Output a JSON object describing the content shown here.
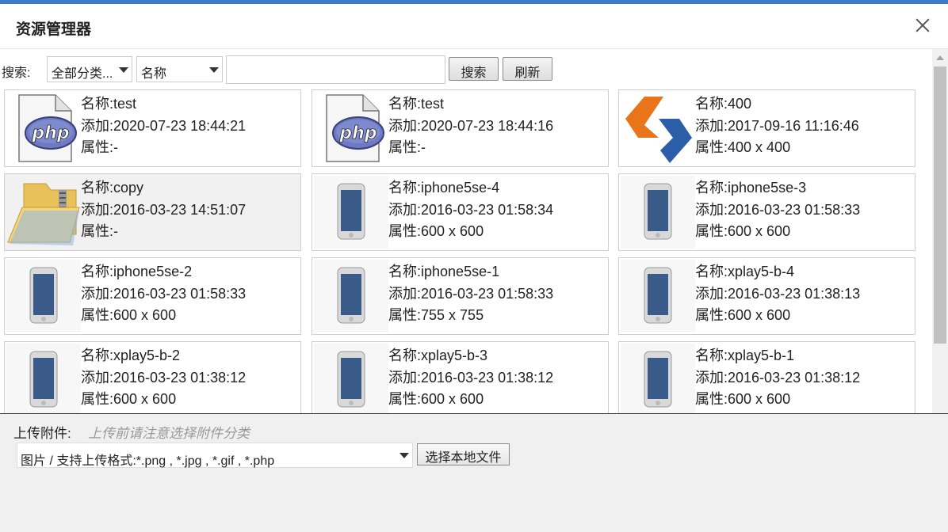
{
  "dialog": {
    "title": "资源管理器",
    "close_label": "×"
  },
  "toolbar": {
    "search_label": "搜索:",
    "category_select": "全部分类...",
    "field_select": "名称",
    "search_input_value": "",
    "search_button": "搜索",
    "refresh_button": "刷新"
  },
  "labels": {
    "name": "名称:",
    "added": "添加:",
    "attr": "属性:"
  },
  "files": [
    {
      "name": "test",
      "added": "2020-07-23 18:44:21",
      "attr": "-",
      "thumb": "php-file-icon"
    },
    {
      "name": "test",
      "added": "2020-07-23 18:44:16",
      "attr": "-",
      "thumb": "php-file-icon"
    },
    {
      "name": "400",
      "added": "2017-09-16 11:16:46",
      "attr": "400 x 400",
      "thumb": "logo-image"
    },
    {
      "name": "copy",
      "added": "2016-03-23 14:51:07",
      "attr": "-",
      "thumb": "zip-folder-icon"
    },
    {
      "name": "iphone5se-4",
      "added": "2016-03-23 01:58:34",
      "attr": "600 x 600",
      "thumb": "phone-image"
    },
    {
      "name": "iphone5se-3",
      "added": "2016-03-23 01:58:33",
      "attr": "600 x 600",
      "thumb": "phone-image"
    },
    {
      "name": "iphone5se-2",
      "added": "2016-03-23 01:58:33",
      "attr": "600 x 600",
      "thumb": "phone-image"
    },
    {
      "name": "iphone5se-1",
      "added": "2016-03-23 01:58:33",
      "attr": "755 x 755",
      "thumb": "phone-image"
    },
    {
      "name": "xplay5-b-4",
      "added": "2016-03-23 01:38:13",
      "attr": "600 x 600",
      "thumb": "phone-image"
    },
    {
      "name": "xplay5-b-2",
      "added": "2016-03-23 01:38:12",
      "attr": "600 x 600",
      "thumb": "phone-image"
    },
    {
      "name": "xplay5-b-3",
      "added": "2016-03-23 01:38:12",
      "attr": "600 x 600",
      "thumb": "phone-image"
    },
    {
      "name": "xplay5-b-1",
      "added": "2016-03-23 01:38:12",
      "attr": "600 x 600",
      "thumb": "phone-image"
    }
  ],
  "upload": {
    "label": "上传附件:",
    "hint": "上传前请注意选择附件分类",
    "file_type_value": "图片 / 支持上传格式:*.png , *.jpg , *.gif , *.php",
    "choose_button": "选择本地文件"
  },
  "colors": {
    "accent_bar": "#3d7dc8",
    "php_blue": "#6270b8",
    "logo_orange": "#e8751a",
    "logo_blue": "#2b5ea7"
  }
}
